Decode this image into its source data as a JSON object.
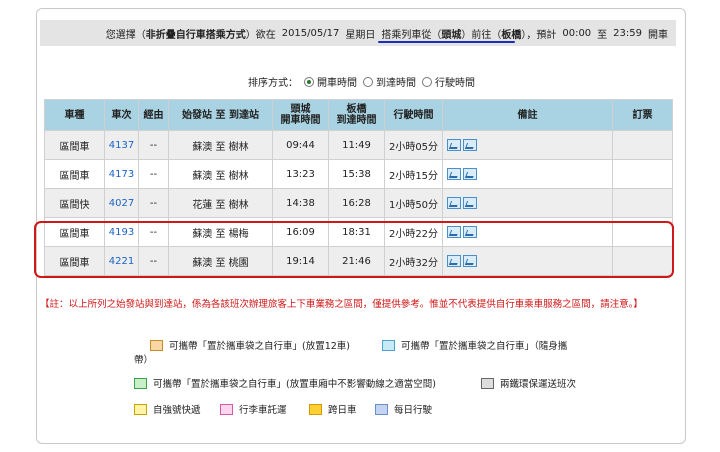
{
  "summary": {
    "prefix": "您選擇（",
    "mode": "非折疊自行車搭乘方式",
    "mid1": "）欲在",
    "date": "2015/05/17",
    "weekday": "星期日",
    "from_label": "搭乘列車從（",
    "from_station": "頭城",
    "to_label": "）前往（",
    "to_station": "板橋",
    "expect": "），預計",
    "start_time": "00:00",
    "to_word": "至",
    "end_time": "23:59",
    "suffix": "開車"
  },
  "sort": {
    "label": "排序方式：",
    "options": [
      "開車時間",
      "到達時間",
      "行駛時間"
    ],
    "selected": "開車時間"
  },
  "table": {
    "headers": {
      "type": "車種",
      "train_no": "車次",
      "via": "經由",
      "route": "始發站 至 到達站",
      "depart_l1": "頭城",
      "depart_l2": "開車時間",
      "arrive_l1": "板橋",
      "arrive_l2": "到達時間",
      "duration": "行駛時間",
      "remarks": "備註",
      "booking": "訂票"
    },
    "rows": [
      {
        "type": "區間車",
        "train_no": "4137",
        "via": "--",
        "route": "蘇澳 至 樹林",
        "depart": "09:44",
        "arrive": "11:49",
        "duration": "2小時05分"
      },
      {
        "type": "區間車",
        "train_no": "4173",
        "via": "--",
        "route": "蘇澳 至 樹林",
        "depart": "13:23",
        "arrive": "15:38",
        "duration": "2小時15分"
      },
      {
        "type": "區間快",
        "train_no": "4027",
        "via": "--",
        "route": "花蓮 至 樹林",
        "depart": "14:38",
        "arrive": "16:28",
        "duration": "1小時50分"
      },
      {
        "type": "區間車",
        "train_no": "4193",
        "via": "--",
        "route": "蘇澳 至 楊梅",
        "depart": "16:09",
        "arrive": "18:31",
        "duration": "2小時22分"
      },
      {
        "type": "區間車",
        "train_no": "4221",
        "via": "--",
        "route": "蘇澳 至 桃園",
        "depart": "19:14",
        "arrive": "21:46",
        "duration": "2小時32分"
      }
    ]
  },
  "note": "【註：以上所列之始發站與到達站，係為各該班次辦理旅客上下車業務之區間，僅提供參考。惟並不代表提供自行車乘車服務之區間，請注意。】",
  "legend": {
    "bike_bag_12": "可攜帶「置於攜車袋之自行車」(放置12車)",
    "bike_bag_carry_1": "可攜帶「置於攜車袋之自行車」（隨身攜",
    "bike_bag_carry_2": "帶）",
    "bike_bag_space": "可攜帶「置於攜車袋之自行車」(放置車廂中不影響動線之適當空間)",
    "two_way": "兩鐵環保運送班次",
    "tze_chiang": "自強號快遞",
    "luggage": "行李車託運",
    "holiday": "跨日車",
    "daily": "每日行駛"
  },
  "colors": {
    "header_bg": "#a9d3e3",
    "highlight": "#d01818",
    "underline": "#1c2fb8",
    "train_link": "#1a63c4"
  }
}
